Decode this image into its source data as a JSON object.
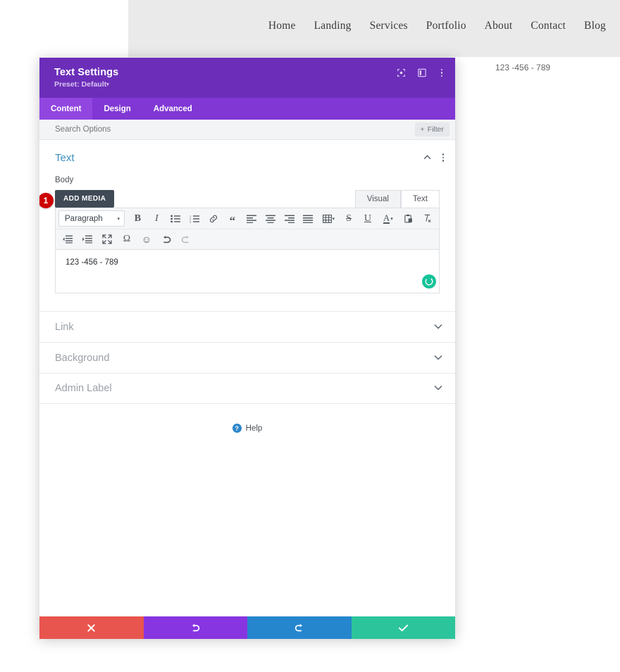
{
  "site": {
    "nav": [
      {
        "label": "Home"
      },
      {
        "label": "Landing"
      },
      {
        "label": "Services"
      },
      {
        "label": "Portfolio"
      },
      {
        "label": "About"
      },
      {
        "label": "Contact"
      },
      {
        "label": "Blog"
      }
    ],
    "page_text": "123 -456 - 789"
  },
  "modal": {
    "title": "Text Settings",
    "preset": "Preset: Default",
    "preset_caret": "▾",
    "header_icons": [
      {
        "name": "focus-target-icon"
      },
      {
        "name": "layout-columns-icon"
      },
      {
        "name": "more-vertical-icon"
      }
    ],
    "tabs": [
      {
        "label": "Content",
        "active": true
      },
      {
        "label": "Design",
        "active": false
      },
      {
        "label": "Advanced",
        "active": false
      }
    ],
    "search": {
      "placeholder": "Search Options",
      "value": ""
    },
    "filter_button": {
      "label": "Filter",
      "icon": "plus-icon"
    },
    "section": {
      "title": "Text",
      "collapse_icon": "chevron-up-icon",
      "menu_icon": "more-vertical-icon"
    },
    "field": {
      "label": "Body",
      "add_media_label": "ADD MEDIA",
      "editor_tabs": [
        {
          "label": "Visual",
          "active": true
        },
        {
          "label": "Text",
          "active": false
        }
      ],
      "format_select": {
        "value": "Paragraph",
        "caret": "▾"
      },
      "toolbar_row1": [
        {
          "name": "bold-icon",
          "glyph": "B",
          "style": "bold"
        },
        {
          "name": "italic-icon",
          "glyph": "I",
          "style": "italic"
        },
        {
          "name": "bulleted-list-icon",
          "glyph": "",
          "style": "svg"
        },
        {
          "name": "numbered-list-icon",
          "glyph": "",
          "style": "svg"
        },
        {
          "name": "link-icon",
          "glyph": "",
          "style": "svg"
        },
        {
          "name": "blockquote-icon",
          "glyph": "“",
          "style": "quote"
        },
        {
          "name": "align-left-icon",
          "glyph": "",
          "style": "svg"
        },
        {
          "name": "align-center-icon",
          "glyph": "",
          "style": "svg"
        },
        {
          "name": "align-right-icon",
          "glyph": "",
          "style": "svg"
        },
        {
          "name": "align-justify-icon",
          "glyph": "",
          "style": "svg"
        },
        {
          "name": "table-icon",
          "glyph": "",
          "style": "svg"
        },
        {
          "name": "strikethrough-icon",
          "glyph": "S",
          "style": "strike"
        },
        {
          "name": "underline-icon",
          "glyph": "U",
          "style": "underline"
        },
        {
          "name": "text-color-icon",
          "glyph": "A",
          "style": "textcolor"
        },
        {
          "name": "paste-as-text-icon",
          "glyph": "",
          "style": "svg"
        },
        {
          "name": "clear-formatting-icon",
          "glyph": "",
          "style": "svg"
        }
      ],
      "toolbar_row2": [
        {
          "name": "decrease-indent-icon"
        },
        {
          "name": "increase-indent-icon"
        },
        {
          "name": "fullscreen-icon"
        },
        {
          "name": "special-character-icon",
          "glyph": "Ω"
        },
        {
          "name": "emoji-icon",
          "glyph": "☺"
        },
        {
          "name": "undo-icon"
        },
        {
          "name": "redo-icon"
        }
      ],
      "content": "123 -456 - 789",
      "grammar_icon": "grammarly-status-icon",
      "step_marker": "1"
    },
    "accordions": [
      {
        "label": "Link",
        "chevron": "chevron-down-icon"
      },
      {
        "label": "Background",
        "chevron": "chevron-down-icon"
      },
      {
        "label": "Admin Label",
        "chevron": "chevron-down-icon"
      }
    ],
    "help": {
      "label": "Help",
      "icon_glyph": "?"
    },
    "footer_buttons": [
      {
        "name": "cancel-button",
        "icon": "close-icon",
        "color": "#e8554e"
      },
      {
        "name": "undo-button",
        "icon": "undo-icon",
        "color": "#8735e0"
      },
      {
        "name": "redo-button",
        "icon": "redo-icon",
        "color": "#2586ce"
      },
      {
        "name": "save-button",
        "icon": "check-icon",
        "color": "#2cc49b"
      }
    ]
  },
  "colors": {
    "header_purple": "#6c2eb9",
    "tabs_purple": "#8037d4",
    "tab_active_purple": "#9146e0",
    "section_title_blue": "#3d8fbf",
    "badge_red": "#cc0000",
    "grammar_green": "#15c39a"
  }
}
